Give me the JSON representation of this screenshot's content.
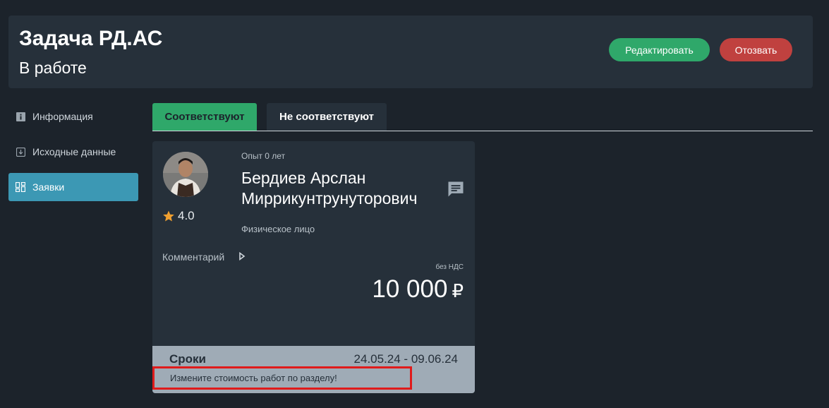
{
  "header": {
    "title": "Задача РД.АС",
    "status": "В работе",
    "edit_label": "Редактировать",
    "revoke_label": "Отозвать"
  },
  "sidebar": {
    "items": [
      {
        "label": "Информация",
        "icon": "info-icon"
      },
      {
        "label": "Исходные данные",
        "icon": "download-icon"
      },
      {
        "label": "Заявки",
        "icon": "dashboard-icon",
        "active": true
      }
    ]
  },
  "tabs": [
    {
      "label": "Соответствуют",
      "active": true
    },
    {
      "label": "Не соответствуют",
      "active": false
    }
  ],
  "card": {
    "experience": "Опыт 0  лет",
    "name": "Бердиев Арслан Миррикунтрунуторович",
    "rating": "4.0",
    "entity_type": "Физическое лицо",
    "comment_label": "Комментарий",
    "vat_note": "без НДС",
    "price": "10 000",
    "currency": "₽",
    "deadline_label": "Сроки",
    "deadline_value": "24.05.24  - 09.06.24",
    "warning": "Измените стоимость работ по разделу!"
  },
  "colors": {
    "accent_green": "#2fa86a",
    "danger_red": "#c0413f",
    "active_blue": "#3c98b4",
    "highlight_red": "#e01b1b"
  }
}
